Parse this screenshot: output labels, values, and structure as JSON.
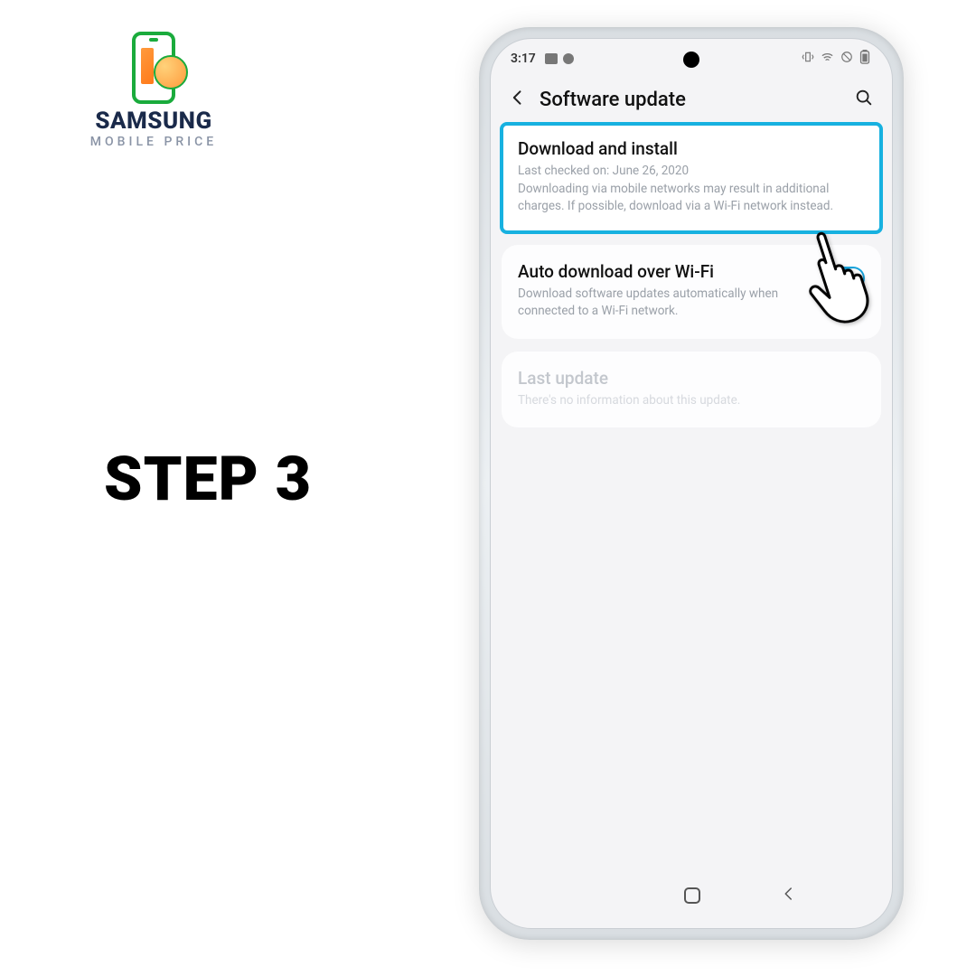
{
  "logo": {
    "main": "SAMSUNG",
    "sub": "MOBILE PRICE"
  },
  "step": "STEP 3",
  "status": {
    "time": "3:17"
  },
  "header": {
    "title": "Software update"
  },
  "cards": {
    "download": {
      "title": "Download and install",
      "sub": "Last checked on: June 26, 2020\nDownloading via mobile networks may result in additional charges. If possible, download via a Wi-Fi network instead."
    },
    "auto": {
      "title": "Auto download over Wi-Fi",
      "sub": "Download software updates automatically when connected to a Wi-Fi network."
    },
    "last": {
      "title": "Last update",
      "sub": "There's no information about this update."
    }
  }
}
